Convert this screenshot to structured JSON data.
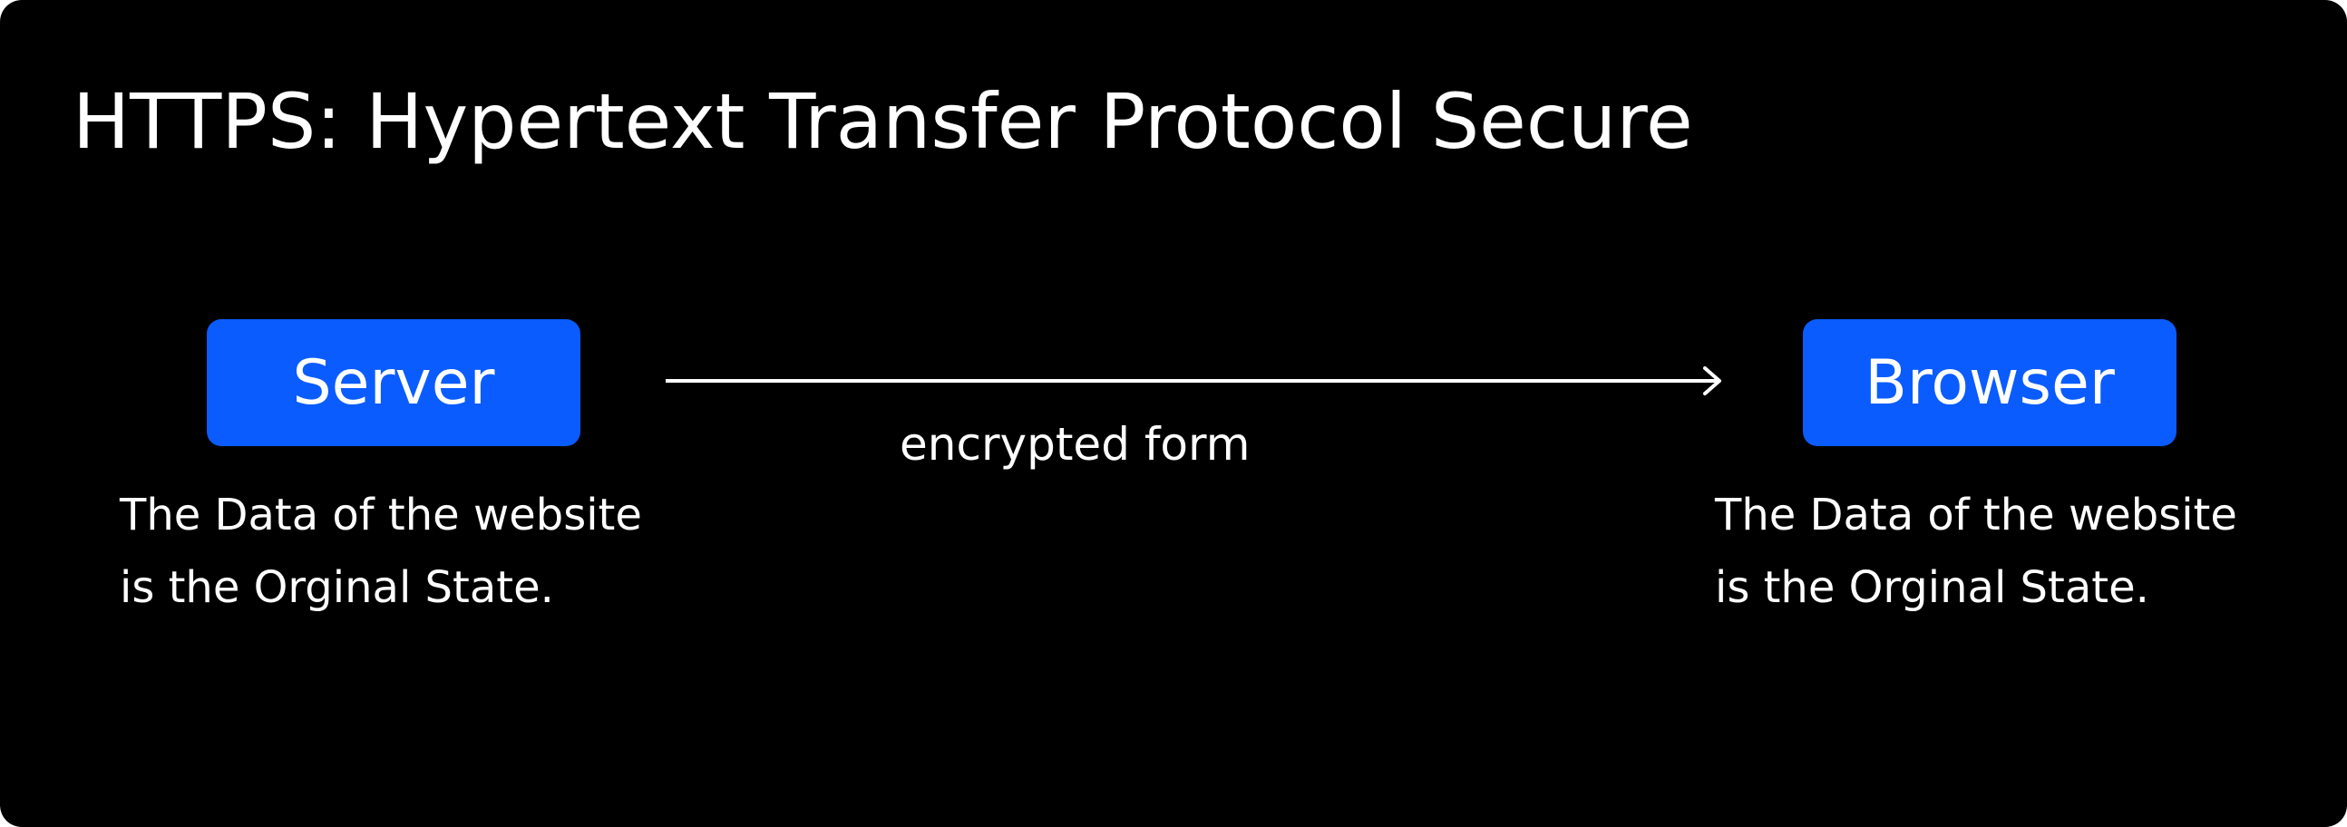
{
  "title": "HTTPS: Hypertext Transfer Protocol Secure",
  "colors": {
    "background": "#000000",
    "node_fill": "#0a5cff",
    "text": "#ffffff"
  },
  "nodes": [
    {
      "label": "Server",
      "caption": [
        "The Data of the website",
        "is the Orginal State."
      ]
    },
    {
      "label": "Browser",
      "caption": [
        "The Data of the website",
        "is the Orginal State."
      ]
    }
  ],
  "edge": {
    "from": "Server",
    "to": "Browser",
    "label": "encrypted form"
  }
}
